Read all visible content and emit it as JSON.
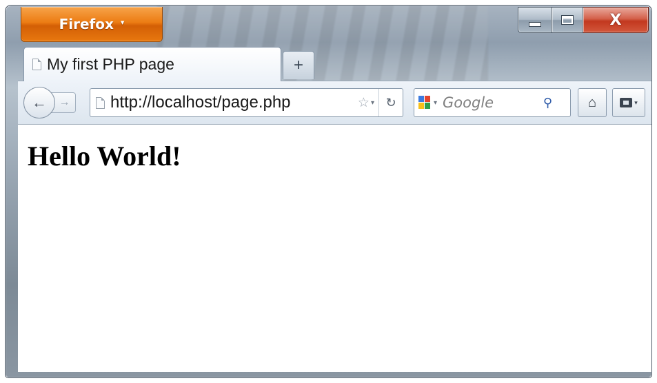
{
  "window": {
    "menu_button_label": "Firefox",
    "menu_button_caret": "▾",
    "close_glyph": "X"
  },
  "tabs": [
    {
      "label": "My first PHP page",
      "active": true
    }
  ],
  "new_tab_label": "+",
  "navbar": {
    "url": "http://localhost/page.php",
    "search_placeholder": "Google",
    "search_engine": "Google"
  },
  "page": {
    "heading": "Hello World!"
  },
  "colors": {
    "firefox_button": "#ec7c13",
    "close_button": "#c2381f",
    "toolbar": "#dde6ef"
  }
}
